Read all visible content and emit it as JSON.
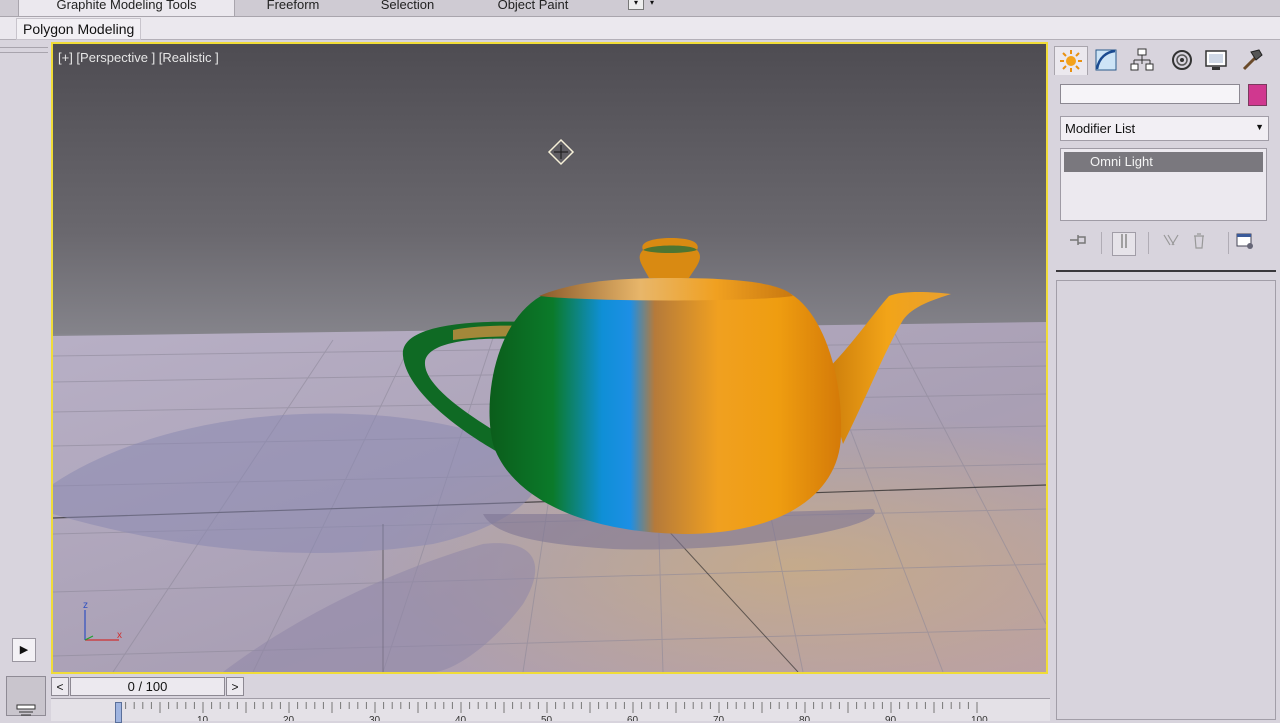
{
  "ribbon": {
    "tabs": [
      {
        "label": "Graphite Modeling Tools",
        "active": true
      },
      {
        "label": "Freeform",
        "active": false
      },
      {
        "label": "Selection",
        "active": false
      },
      {
        "label": "Object Paint",
        "active": false
      }
    ],
    "panel_label": "Polygon Modeling"
  },
  "viewport": {
    "label": "[+] [Perspective ] [Realistic ]",
    "axis_labels": {
      "x": "x",
      "z": "z"
    },
    "border_color": "#f0dc38"
  },
  "command_panel": {
    "tabs": [
      {
        "icon": "create-icon"
      },
      {
        "icon": "modify-icon"
      },
      {
        "icon": "hierarchy-icon"
      },
      {
        "icon": "motion-icon"
      },
      {
        "icon": "display-icon"
      },
      {
        "icon": "utilities-icon"
      }
    ],
    "object_name": "",
    "object_color": "#d0388f",
    "modifier_list_label": "Modifier List",
    "modifier_stack": [
      "Omni Light"
    ]
  },
  "time_slider": {
    "value": "0 / 100",
    "prev_label": "<",
    "next_label": ">"
  },
  "track_bar": {
    "tick_labels": [
      "10",
      "20",
      "30",
      "40",
      "50",
      "60",
      "70",
      "80",
      "90",
      "100"
    ]
  }
}
